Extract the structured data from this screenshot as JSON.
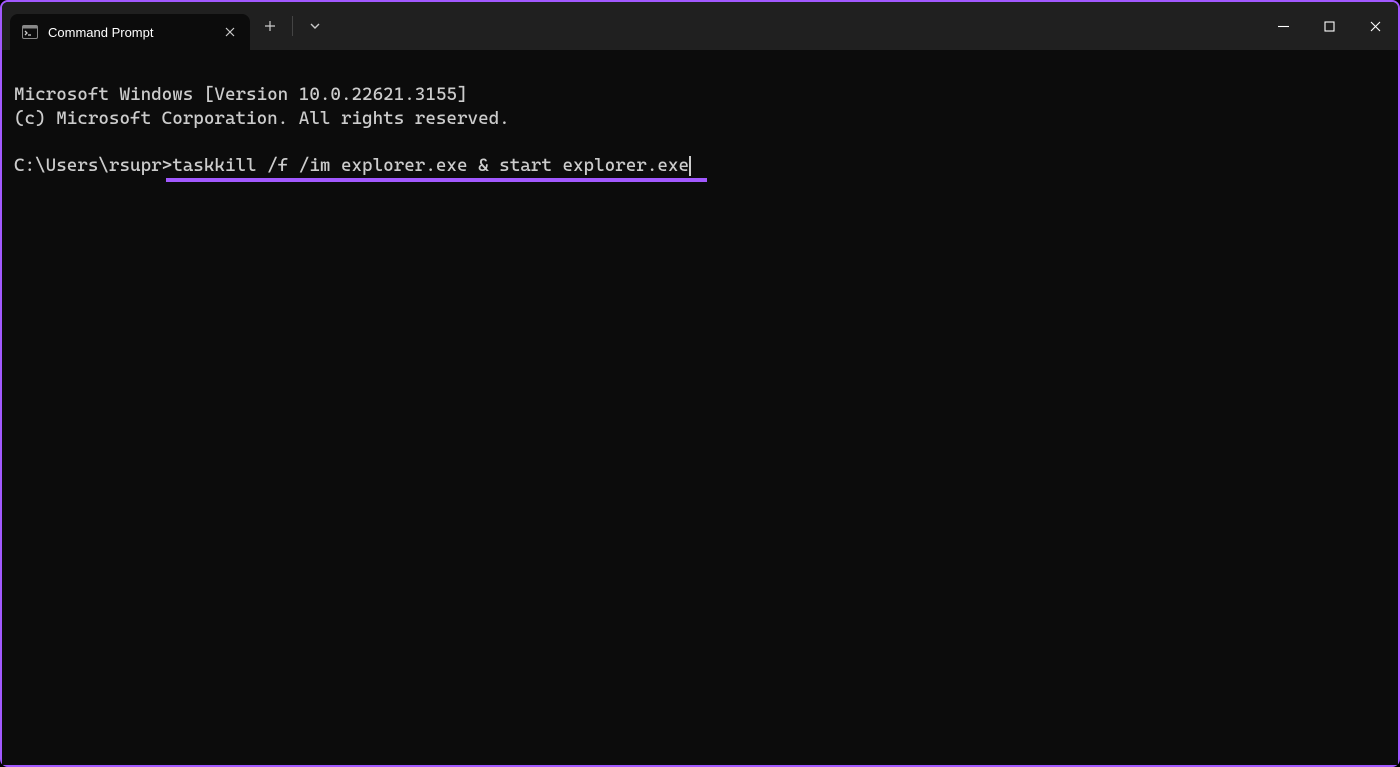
{
  "window": {
    "tab_title": "Command Prompt"
  },
  "terminal": {
    "line1": "Microsoft Windows [Version 10.0.22621.3155]",
    "line2": "(c) Microsoft Corporation. All rights reserved.",
    "prompt": "C:\\Users\\rsupr>",
    "command": "taskkill /f /im explorer.exe & start explorer.exe"
  },
  "colors": {
    "accent": "#a259ff",
    "terminal_bg": "#0c0c0c",
    "titlebar_bg": "#202020",
    "text": "#cccccc"
  }
}
